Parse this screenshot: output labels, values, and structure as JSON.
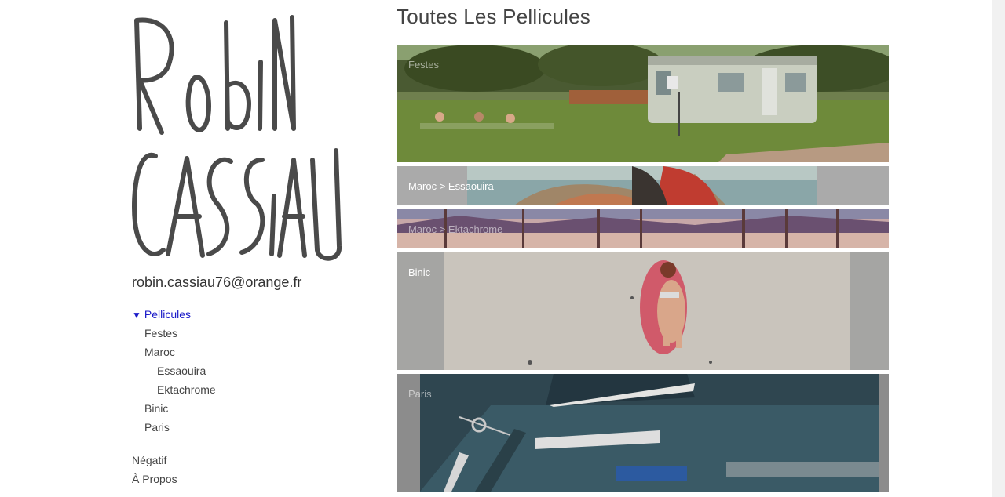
{
  "logo": {
    "line1": "Robin",
    "line2": "CASSiAU"
  },
  "email": "robin.cassiau76@orange.fr",
  "nav": {
    "pellicules": "Pellicules",
    "festes": "Festes",
    "maroc": "Maroc",
    "essaouira": "Essaouira",
    "ektachrome": "Ektachrome",
    "binic": "Binic",
    "paris": "Paris",
    "negatif": "Négatif",
    "apropos": "À Propos"
  },
  "page_title": "Toutes Les Pellicules",
  "films": {
    "festes": "Festes",
    "essaouira": "Maroc > Essaouira",
    "ektachrome": "Maroc > Ektachrome",
    "binic": "Binic",
    "paris": "Paris"
  },
  "colors": {
    "link_active": "#1a1ac8",
    "text": "#444444"
  }
}
